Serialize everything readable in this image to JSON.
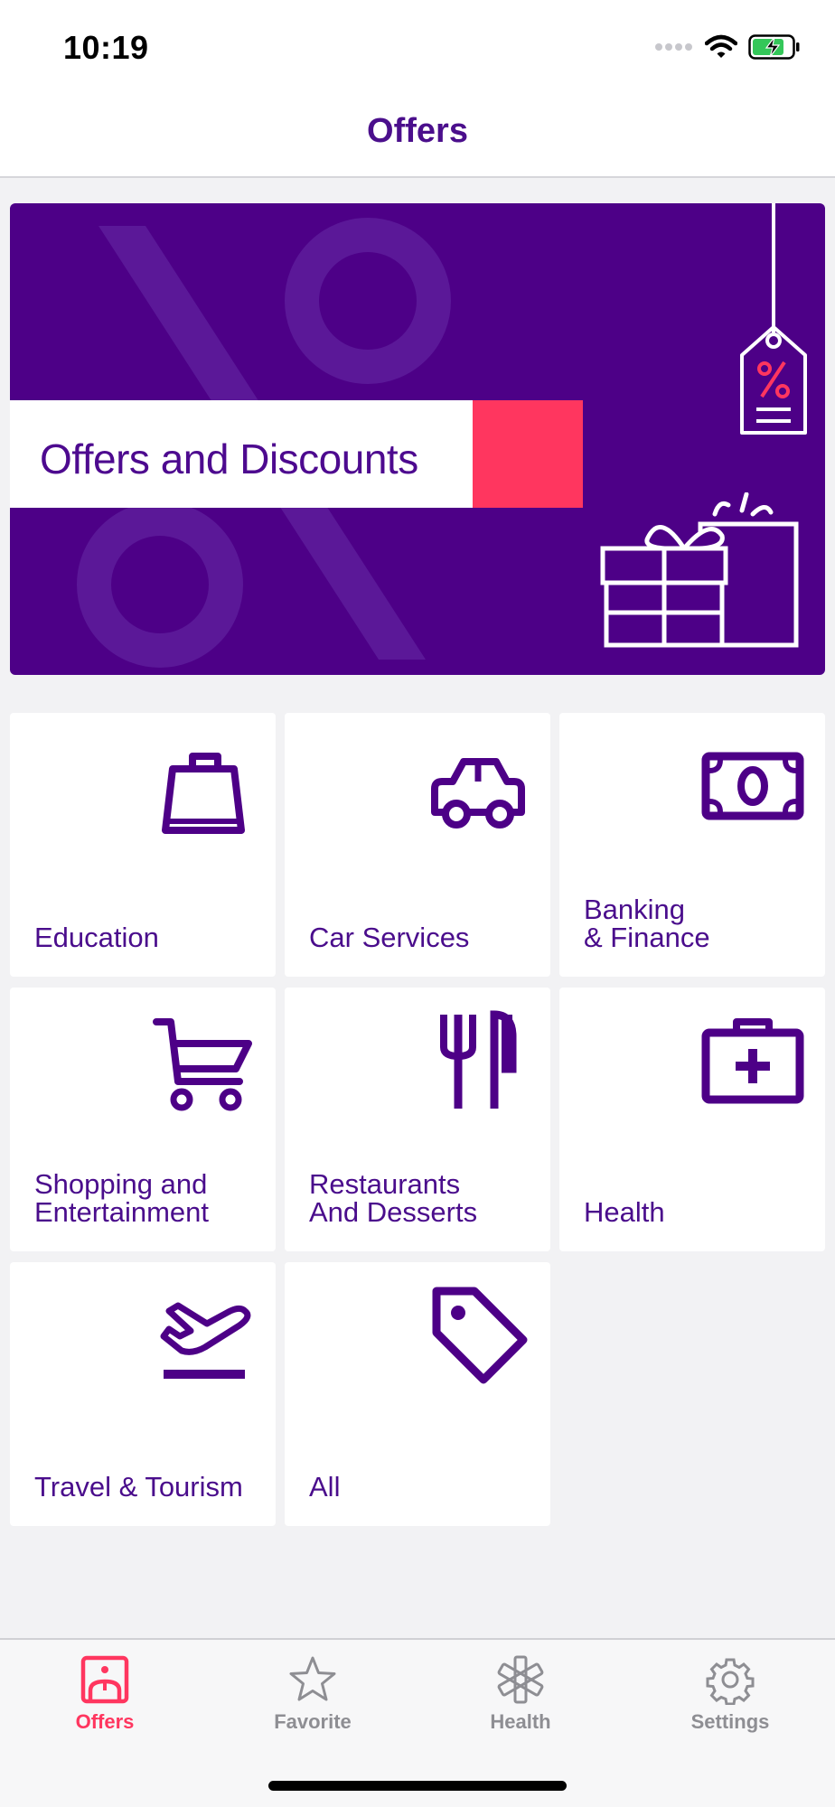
{
  "status_bar": {
    "time": "10:19"
  },
  "nav": {
    "title": "Offers"
  },
  "banner": {
    "title": "Offers and Discounts"
  },
  "categories": [
    {
      "label": "Education",
      "icon": "shopping-bag-icon"
    },
    {
      "label": "Car Services",
      "icon": "car-icon"
    },
    {
      "label": "Banking\n& Finance",
      "icon": "banknote-icon"
    },
    {
      "label": "Shopping and\nEntertainment",
      "icon": "shopping-cart-icon"
    },
    {
      "label": "Restaurants\nAnd Desserts",
      "icon": "fork-knife-icon"
    },
    {
      "label": "Health",
      "icon": "medical-kit-icon"
    },
    {
      "label": "Travel & Tourism",
      "icon": "airplane-takeoff-icon"
    },
    {
      "label": "All",
      "icon": "price-tag-icon"
    }
  ],
  "tabs": [
    {
      "label": "Offers",
      "icon": "offers-tag-icon",
      "active": true
    },
    {
      "label": "Favorite",
      "icon": "star-icon",
      "active": false
    },
    {
      "label": "Health",
      "icon": "asterisk-icon",
      "active": false
    },
    {
      "label": "Settings",
      "icon": "gear-icon",
      "active": false
    }
  ],
  "colors": {
    "brand_purple": "#4d0087",
    "accent_red": "#ff365f",
    "background": "#f2f2f4"
  }
}
